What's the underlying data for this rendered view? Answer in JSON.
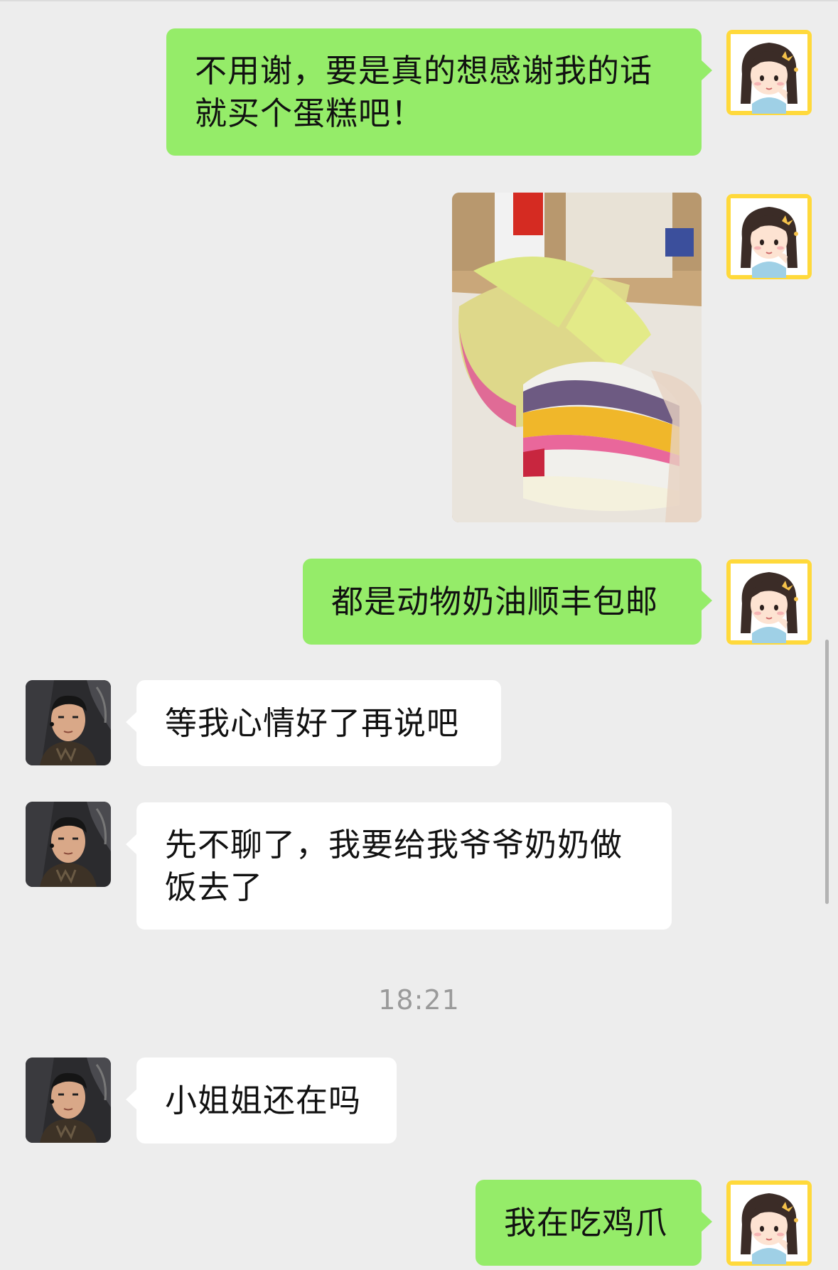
{
  "chat": {
    "messages": [
      {
        "side": "right",
        "type": "text",
        "text": "不用谢，要是真的想感谢我的话就买个蛋糕吧！"
      },
      {
        "side": "right",
        "type": "image",
        "image": "rainbow-cake-photo"
      },
      {
        "side": "right",
        "type": "text",
        "text": "都是动物奶油顺丰包邮"
      },
      {
        "side": "left",
        "type": "text",
        "text": "等我心情好了再说吧"
      },
      {
        "side": "left",
        "type": "text",
        "text": "先不聊了，我要给我爷爷奶奶做饭去了"
      },
      {
        "side": "left",
        "type": "text",
        "text": "小姐姐还在吗"
      },
      {
        "side": "right",
        "type": "text",
        "text": "我在吃鸡爪"
      }
    ],
    "timestamp": "18:21"
  },
  "icons": {
    "self_avatar": "cartoon-girl-avatar",
    "contact_avatar": "man-selfie-avatar"
  },
  "colors": {
    "background": "#ededed",
    "outgoing_bubble": "#95ec69",
    "incoming_bubble": "#ffffff",
    "avatar_frame": "#ffd93b"
  }
}
